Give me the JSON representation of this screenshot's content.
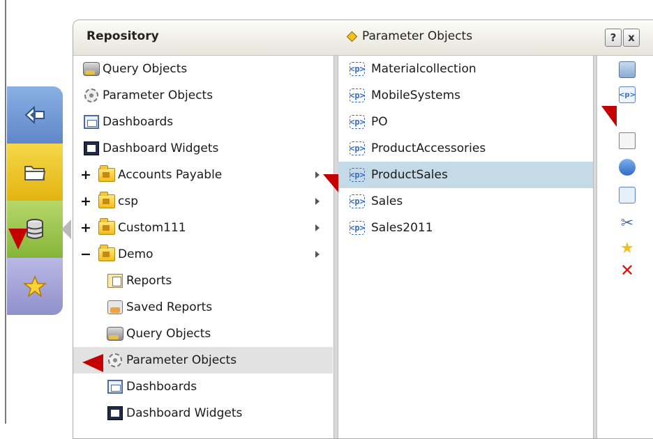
{
  "panel": {
    "title": "Repository",
    "breadcrumb": "Parameter Objects",
    "help_label": "?",
    "close_label": "x"
  },
  "side_tabs": [
    {
      "icon": "back-arrow-icon"
    },
    {
      "icon": "open-folder-icon"
    },
    {
      "icon": "database-icon"
    },
    {
      "icon": "star-icon"
    }
  ],
  "tree": [
    {
      "label": "Query Objects",
      "icon": "query-objects-icon",
      "expander": "",
      "arrow": false
    },
    {
      "label": "Parameter Objects",
      "icon": "parameter-objects-icon",
      "expander": "",
      "arrow": false
    },
    {
      "label": "Dashboards",
      "icon": "dashboards-icon",
      "expander": "",
      "arrow": false
    },
    {
      "label": "Dashboard Widgets",
      "icon": "dashboard-widgets-icon",
      "expander": "",
      "arrow": false
    },
    {
      "label": "Accounts Payable",
      "icon": "folder-icon",
      "expander": "+",
      "arrow": true
    },
    {
      "label": "csp",
      "icon": "folder-icon",
      "expander": "+",
      "arrow": true
    },
    {
      "label": "Custom111",
      "icon": "folder-icon",
      "expander": "+",
      "arrow": true
    },
    {
      "label": "Demo",
      "icon": "folder-icon",
      "expander": "−",
      "arrow": true
    },
    {
      "label": "Reports",
      "icon": "reports-icon",
      "expander": "",
      "arrow": false
    },
    {
      "label": "Saved Reports",
      "icon": "saved-reports-icon",
      "expander": "",
      "arrow": false
    },
    {
      "label": "Query Objects",
      "icon": "query-objects-icon",
      "expander": "",
      "arrow": false
    },
    {
      "label": "Parameter Objects",
      "icon": "parameter-objects-icon",
      "expander": "",
      "arrow": false,
      "selected": true
    },
    {
      "label": "Dashboards",
      "icon": "dashboards-icon",
      "expander": "",
      "arrow": false
    },
    {
      "label": "Dashboard Widgets",
      "icon": "dashboard-widgets-icon",
      "expander": "",
      "arrow": false
    }
  ],
  "objects": [
    {
      "label": "Materialcollection",
      "icon": "parameter-object-icon"
    },
    {
      "label": "MobileSystems",
      "icon": "parameter-object-icon"
    },
    {
      "label": "PO",
      "icon": "parameter-object-icon"
    },
    {
      "label": "ProductAccessories",
      "icon": "parameter-object-icon"
    },
    {
      "label": "ProductSales",
      "icon": "parameter-object-icon",
      "selected": true
    },
    {
      "label": "Sales",
      "icon": "parameter-object-icon"
    },
    {
      "label": "Sales2011",
      "icon": "parameter-object-icon"
    }
  ],
  "object_icon_glyph": "<p>",
  "toolbar": [
    {
      "icon": "edit-icon"
    },
    {
      "icon": "new-parameter-object-icon",
      "glyph": "<p>"
    },
    {
      "icon": "properties-icon"
    },
    {
      "icon": "permissions-icon"
    },
    {
      "icon": "copy-icon"
    },
    {
      "icon": "cut-icon",
      "glyph": "✂"
    },
    {
      "icon": "add-favorite-icon",
      "glyph": "★"
    },
    {
      "icon": "delete-icon",
      "glyph": "✕"
    }
  ],
  "colors": {
    "selected_object": "#c4dbe7",
    "selected_tree": "#e2e2e2",
    "annotation": "#c40000"
  }
}
